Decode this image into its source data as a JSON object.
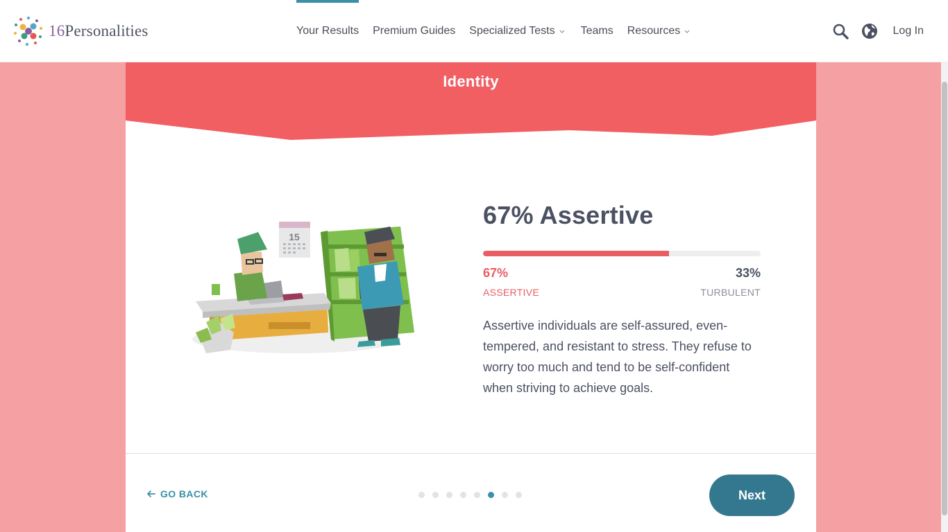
{
  "header": {
    "logo_number": "16",
    "logo_word": "Personalities",
    "nav": [
      {
        "label": "Your Results",
        "active": true
      },
      {
        "label": "Premium Guides"
      },
      {
        "label": "Specialized Tests",
        "dropdown": true
      },
      {
        "label": "Teams"
      },
      {
        "label": "Resources",
        "dropdown": true
      }
    ],
    "search_icon": "search-icon",
    "language_icon": "globe-icon",
    "login_label": "Log In"
  },
  "section": {
    "title": "Identity",
    "banner_color": "#f25f63"
  },
  "result": {
    "title": "67% Assertive",
    "fill_fraction": 0.67,
    "left_percent": "67%",
    "right_percent": "33%",
    "left_label": "ASSERTIVE",
    "right_label": "TURBULENT",
    "description": "Assertive individuals are self-assured, even-tempered, and resistant to stress. They refuse to worry too much and tend to be self-confident when striving to achieve goals.",
    "accent_color": "#e95e63"
  },
  "illustration": {
    "calendar_day": "15"
  },
  "footer": {
    "back_label": "GO BACK",
    "back_icon": "arrow-left-icon",
    "dots": 8,
    "active_dot": 6,
    "next_label": "Next",
    "next_color": "#34788f"
  }
}
